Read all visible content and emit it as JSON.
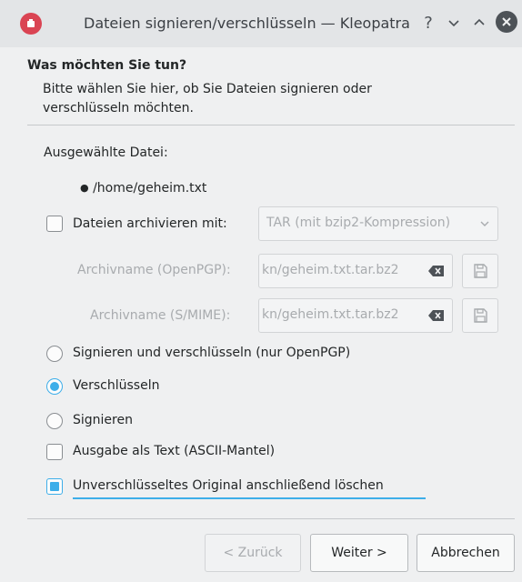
{
  "window": {
    "title": "Dateien signieren/verschlüsseln — Kleopatra",
    "help_glyph": "?",
    "minimize_glyph": "⌄",
    "maximize_glyph": "⌃",
    "icons": {
      "app": "kleopatra-app-icon",
      "close": "close-icon"
    }
  },
  "page": {
    "title": "Was möchten Sie tun?",
    "subtitle": "Bitte wählen Sie hier, ob Sie Dateien signieren oder verschlüsseln möchten."
  },
  "selected": {
    "label": "Ausgewählte Datei:",
    "file": "/home/geheim.txt"
  },
  "archive": {
    "checkbox_label": "Dateien archivieren mit:",
    "checked": false,
    "combo_value": "TAR (mit bzip2-Kompression)",
    "openpgp_label": "Archivname (OpenPGP):",
    "openpgp_value": "kn/geheim.txt.tar.bz2",
    "smime_label": "Archivname (S/MIME):",
    "smime_value": "kn/geheim.txt.tar.bz2"
  },
  "mode": {
    "options": [
      {
        "label": "Signieren und verschlüsseln (nur OpenPGP)",
        "checked": false
      },
      {
        "label": "Verschlüsseln",
        "checked": true
      },
      {
        "label": "Signieren",
        "checked": false
      }
    ]
  },
  "options": {
    "ascii_label": "Ausgabe als Text (ASCII-Mantel)",
    "ascii_checked": false,
    "delete_label": "Unverschlüsseltes Original anschließend löschen",
    "delete_checked": true
  },
  "buttons": {
    "back": "< Zurück",
    "next": "Weiter >",
    "cancel": "Abbrechen"
  },
  "colors": {
    "accent": "#3daee9",
    "app_icon": "#da4453"
  }
}
